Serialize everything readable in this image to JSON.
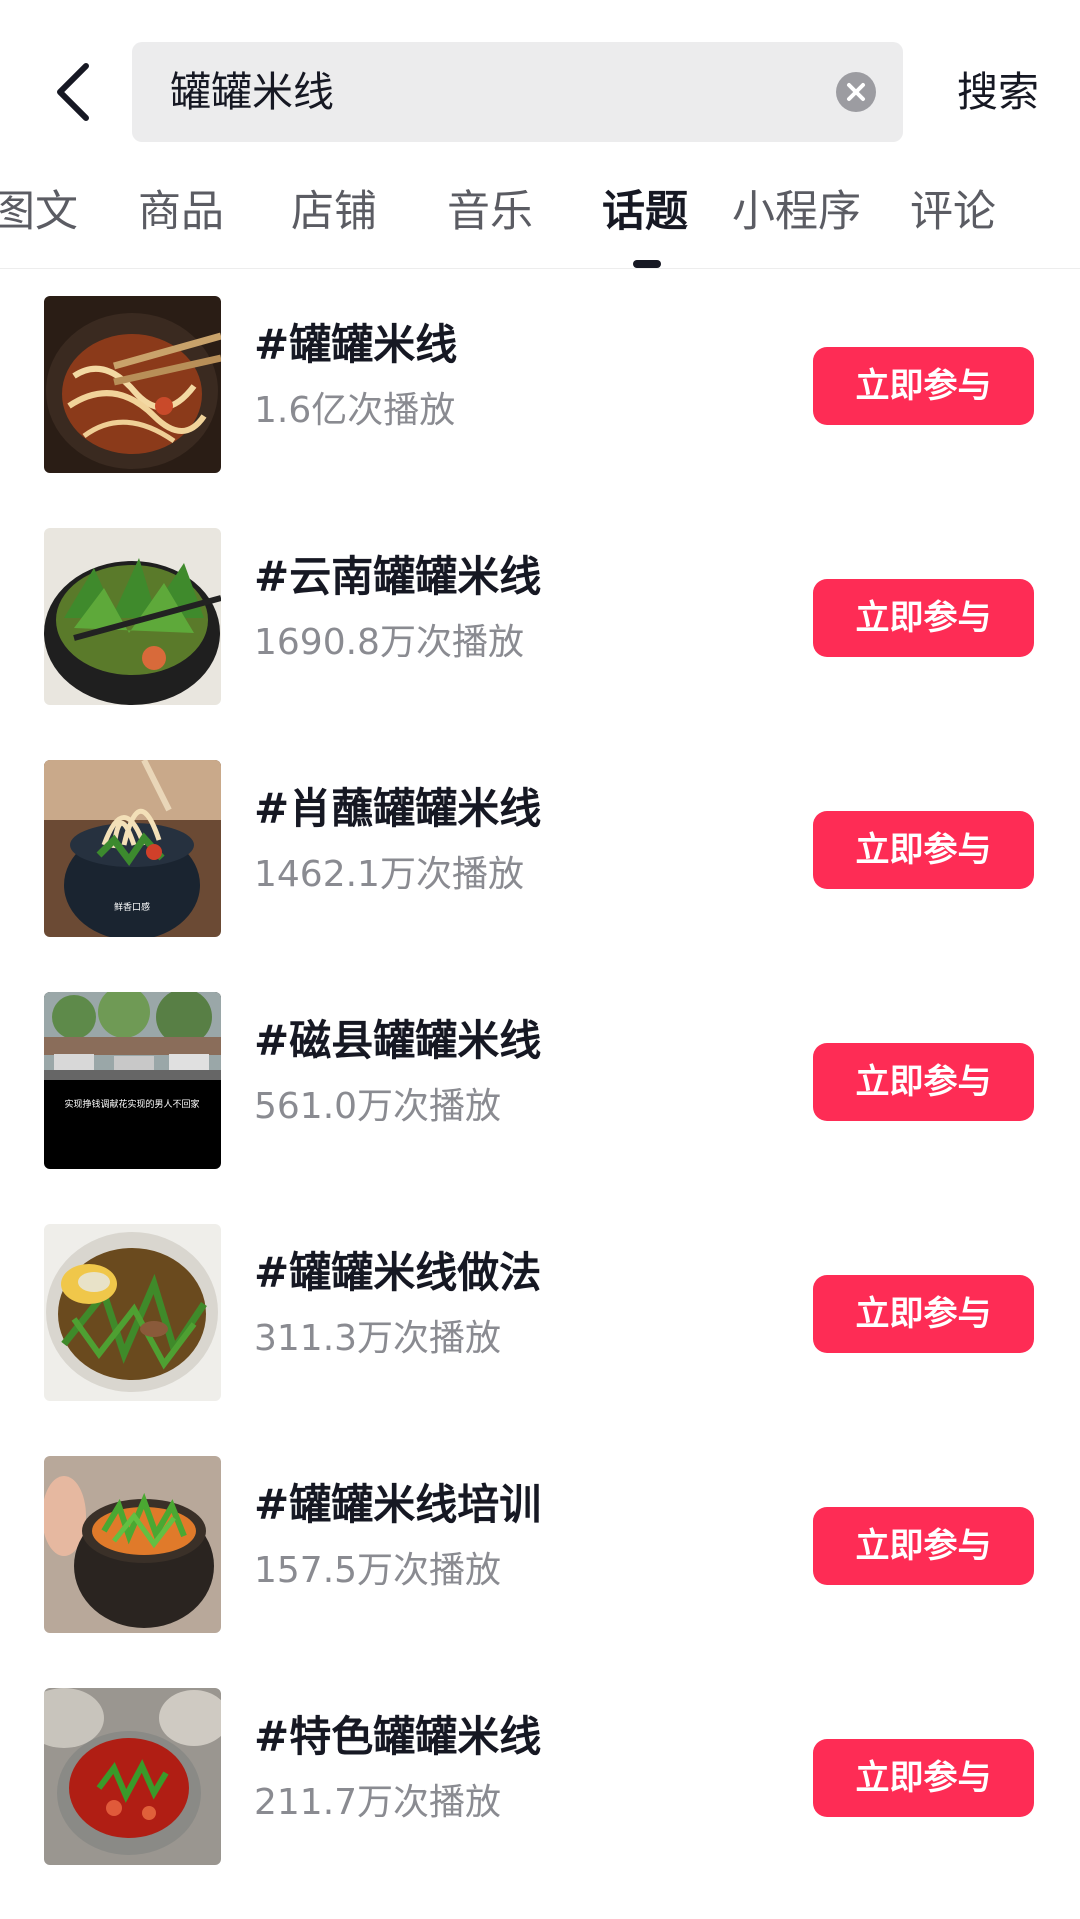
{
  "colors": {
    "accent": "#fe2c55",
    "search_bg": "#ececed",
    "primary_text": "#161823",
    "secondary_text": "#8a8b91"
  },
  "header": {
    "back_icon": "chevron-left-icon",
    "search_value": "罐罐米线",
    "clear_icon": "clear-circle-icon",
    "search_label": "搜索"
  },
  "tabs": [
    {
      "label": "图文",
      "active": false
    },
    {
      "label": "商品",
      "active": false
    },
    {
      "label": "店铺",
      "active": false
    },
    {
      "label": "音乐",
      "active": false
    },
    {
      "label": "话题",
      "active": true
    },
    {
      "label": "小程序",
      "active": false
    },
    {
      "label": "评论",
      "active": false
    }
  ],
  "topics": [
    {
      "title": "#罐罐米线",
      "views": "1.6亿次播放",
      "button": "立即参与"
    },
    {
      "title": "#云南罐罐米线",
      "views": "1690.8万次播放",
      "button": "立即参与"
    },
    {
      "title": "#肖蘸罐罐米线",
      "views": "1462.1万次播放",
      "button": "立即参与"
    },
    {
      "title": "#磁县罐罐米线",
      "views": "561.0万次播放",
      "button": "立即参与"
    },
    {
      "title": "#罐罐米线做法",
      "views": "311.3万次播放",
      "button": "立即参与"
    },
    {
      "title": "#罐罐米线培训",
      "views": "157.5万次播放",
      "button": "立即参与"
    },
    {
      "title": "#特色罐罐米线",
      "views": "211.7万次播放",
      "button": "立即参与"
    }
  ],
  "thumb_captions": {
    "row3": "鲜香口感",
    "row4": "实现挣钱调献花实现的男人不回家"
  }
}
